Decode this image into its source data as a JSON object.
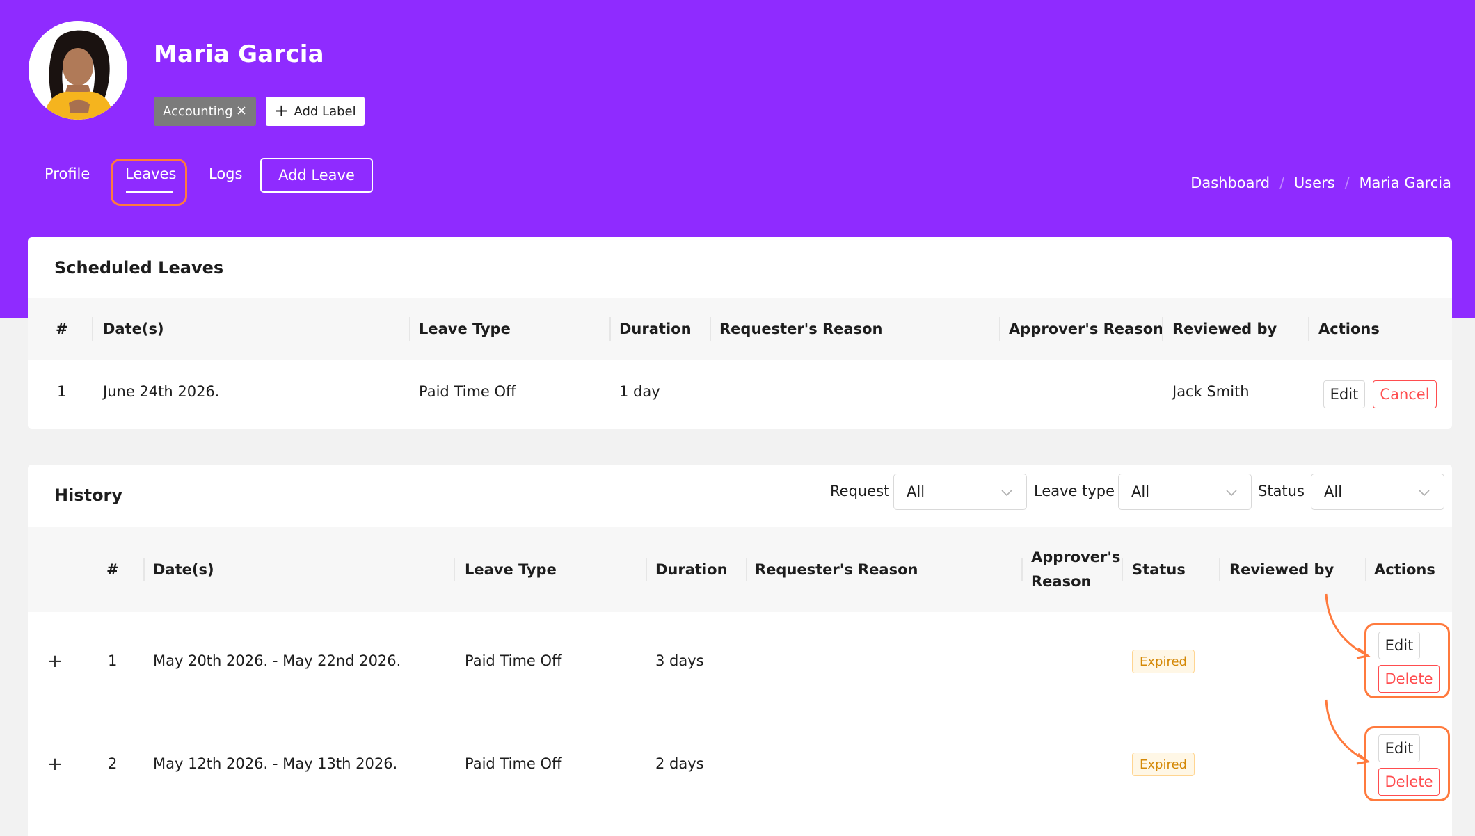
{
  "user": {
    "name": "Maria Garcia",
    "avatar": "avatar-photo"
  },
  "labels": [
    {
      "text": "Accounting"
    }
  ],
  "add_label": "Add Label",
  "tabs": {
    "profile": "Profile",
    "leaves": "Leaves",
    "logs": "Logs"
  },
  "add_leave": "Add Leave",
  "breadcrumb": {
    "items": [
      "Dashboard",
      "Users",
      "Maria Garcia"
    ],
    "separator": "/"
  },
  "colors": {
    "brand": "#8f2bff",
    "highlight": "#ff7a3d",
    "danger": "#ff4d4f",
    "warning": "#d48806"
  },
  "scheduled": {
    "title": "Scheduled Leaves",
    "headers": [
      "#",
      "Date(s)",
      "Leave Type",
      "Duration",
      "Requester's Reason",
      "Approver's Reason",
      "Reviewed by",
      "Actions"
    ],
    "rows": [
      {
        "num": "1",
        "dates": "June 24th 2026.",
        "type": "Paid Time Off",
        "duration": "1 day",
        "requester_reason": "",
        "approver_reason": "",
        "reviewed_by": "Jack Smith",
        "edit": "Edit",
        "cancel": "Cancel"
      }
    ]
  },
  "history": {
    "title": "History",
    "filters": {
      "request": {
        "label": "Request",
        "value": "All"
      },
      "leave_type": {
        "label": "Leave type",
        "value": "All"
      },
      "status": {
        "label": "Status",
        "value": "All"
      }
    },
    "headers": {
      "num": "#",
      "dates": "Date(s)",
      "type": "Leave Type",
      "duration": "Duration",
      "requester_reason": "Requester's Reason",
      "approver_line1": "Approver's",
      "approver_line2": "Reason",
      "status": "Status",
      "reviewed_by": "Reviewed by",
      "actions": "Actions"
    },
    "rows": [
      {
        "num": "1",
        "dates": "May 20th 2026. - May 22nd 2026.",
        "type": "Paid Time Off",
        "duration": "3 days",
        "status": "Expired",
        "reviewed_by": "",
        "edit": "Edit",
        "delete": "Delete"
      },
      {
        "num": "2",
        "dates": "May 12th 2026. - May 13th 2026.",
        "type": "Paid Time Off",
        "duration": "2 days",
        "status": "Expired",
        "reviewed_by": "",
        "edit": "Edit",
        "delete": "Delete"
      }
    ]
  }
}
